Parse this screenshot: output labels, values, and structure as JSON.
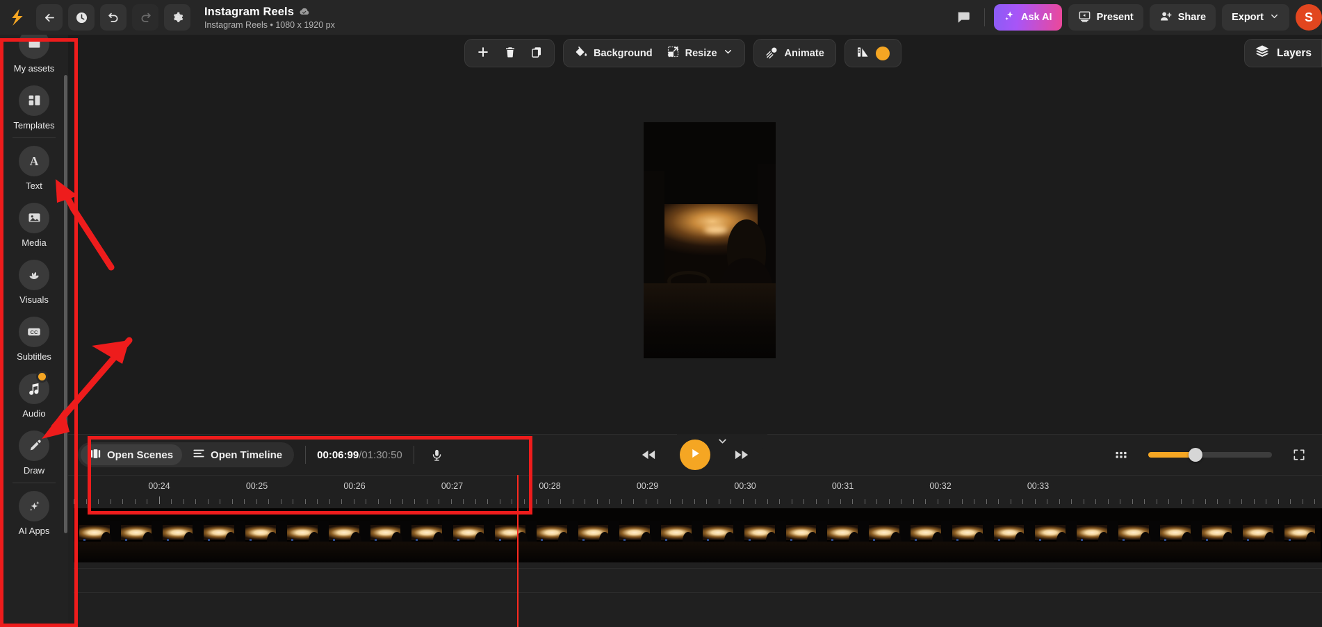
{
  "app": {
    "header": {
      "logo_icon": "lightning-logo",
      "nav_buttons": [
        {
          "name": "back-button",
          "icon": "arrow-left-icon",
          "disabled": false
        },
        {
          "name": "history-button",
          "icon": "clock-icon",
          "disabled": false
        },
        {
          "name": "undo-button",
          "icon": "undo-icon",
          "disabled": false
        },
        {
          "name": "redo-button",
          "icon": "redo-icon",
          "disabled": true
        },
        {
          "name": "settings-button",
          "icon": "gear-icon",
          "disabled": false
        }
      ],
      "doc_title": "Instagram Reels",
      "doc_saved_icon": "cloud-check-icon",
      "doc_subtitle": "Instagram Reels • 1080 x 1920 px",
      "comment_icon": "comment-icon",
      "ask_ai_label": "Ask AI",
      "ask_ai_icon": "sparkles-icon",
      "ask_ai_gradient_from": "#8b5cf6",
      "ask_ai_gradient_to": "#ec4899",
      "present_label": "Present",
      "present_icon": "present-screen-icon",
      "share_label": "Share",
      "share_icon": "person-add-icon",
      "export_label": "Export",
      "export_chevron_icon": "chevron-down-icon",
      "avatar_initial": "S",
      "avatar_color": "#e2461f"
    },
    "sidebar": {
      "items": [
        {
          "label": "My assets",
          "icon": "folder-assets-icon",
          "badge": false
        },
        {
          "label": "Templates",
          "icon": "templates-grid-icon",
          "badge": false
        },
        {
          "label": "Text",
          "icon": "letter-a-icon",
          "badge": false
        },
        {
          "label": "Media",
          "icon": "image-icon",
          "badge": false
        },
        {
          "label": "Visuals",
          "icon": "lotus-icon",
          "badge": false
        },
        {
          "label": "Subtitles",
          "icon": "cc-icon",
          "badge": false
        },
        {
          "label": "Audio",
          "icon": "music-note-icon",
          "badge": true
        },
        {
          "label": "Draw",
          "icon": "pen-icon",
          "badge": false
        },
        {
          "label": "AI Apps",
          "icon": "sparkles-icon",
          "badge": false
        }
      ]
    },
    "toolbar": {
      "add_label": "",
      "add_icon": "plus-icon",
      "delete_icon": "trash-icon",
      "duplicate_icon": "duplicate-icon",
      "background_label": "Background",
      "background_icon": "paint-bucket-icon",
      "resize_label": "Resize",
      "resize_icon": "resize-corner-icon",
      "resize_chevron_icon": "chevron-down-icon",
      "animate_label": "Animate",
      "animate_icon": "motion-comet-icon",
      "palette_icon": "color-palette-icon",
      "palette_swatch_color": "#f5a623",
      "layers_label": "Layers",
      "layers_icon": "layers-stack-icon"
    },
    "timeline": {
      "collapse_icon": "chevron-down-icon",
      "open_scenes_label": "Open Scenes",
      "open_scenes_icon": "scenes-film-icon",
      "open_timeline_label": "Open Timeline",
      "open_timeline_icon": "timeline-lines-icon",
      "current_time": "00:06:99",
      "time_separator": "/",
      "total_time": "01:30:50",
      "mic_icon": "microphone-icon",
      "rewind_icon": "rewind-icon",
      "play_icon": "play-icon",
      "play_button_color": "#f5a623",
      "forward_icon": "fast-forward-icon",
      "grid_view_icon": "grid-dots-icon",
      "fullscreen_icon": "fullscreen-icon",
      "zoom_slider_percent": 38,
      "zoom_slider_color": "#f5a623",
      "ruler_ticks": [
        "00:24",
        "00:25",
        "00:26",
        "00:27",
        "00:28",
        "00:29",
        "00:30",
        "00:31",
        "00:32",
        "00:33"
      ],
      "playhead_color": "#ff2a20",
      "filmstrip_frame_count": 30
    },
    "annotations": {
      "highlight_color": "#ee1c1c",
      "boxes": [
        {
          "name": "sidebar-highlight"
        },
        {
          "name": "timeline-controls-highlight"
        }
      ],
      "arrows": [
        {
          "name": "arrow-to-text-item"
        },
        {
          "name": "arrow-to-audio-item"
        }
      ]
    }
  }
}
